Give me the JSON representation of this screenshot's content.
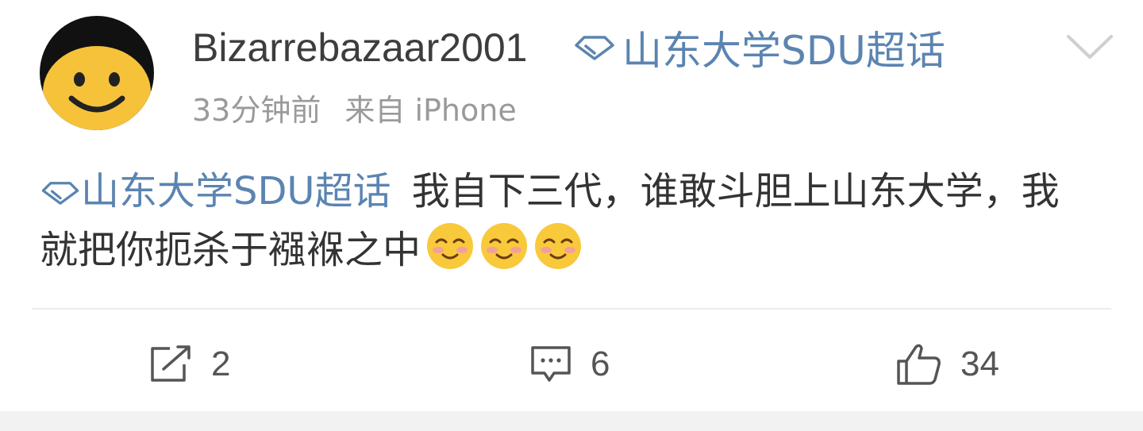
{
  "post": {
    "username": "Bizarrebazaar2001",
    "topic": "山东大学SDU超话",
    "time": "33分钟前",
    "source": "来自 iPhone",
    "content_text": "我自下三代，谁敢斗胆上山东大学，我就把你扼杀于襁褓之中",
    "emojis": [
      "smiling-blush-emoji",
      "smiling-blush-emoji",
      "smiling-blush-emoji"
    ]
  },
  "actions": {
    "repost_count": "2",
    "comment_count": "6",
    "like_count": "34"
  },
  "colors": {
    "link": "#5b84b1",
    "meta": "#9a9a9a",
    "text": "#333333",
    "avatar": "#f6c23a"
  },
  "icons": {
    "header_menu": "chevron-down-icon",
    "topic": "diamond-icon",
    "repost": "repost-icon",
    "comment": "comment-icon",
    "like": "thumbs-up-icon"
  }
}
